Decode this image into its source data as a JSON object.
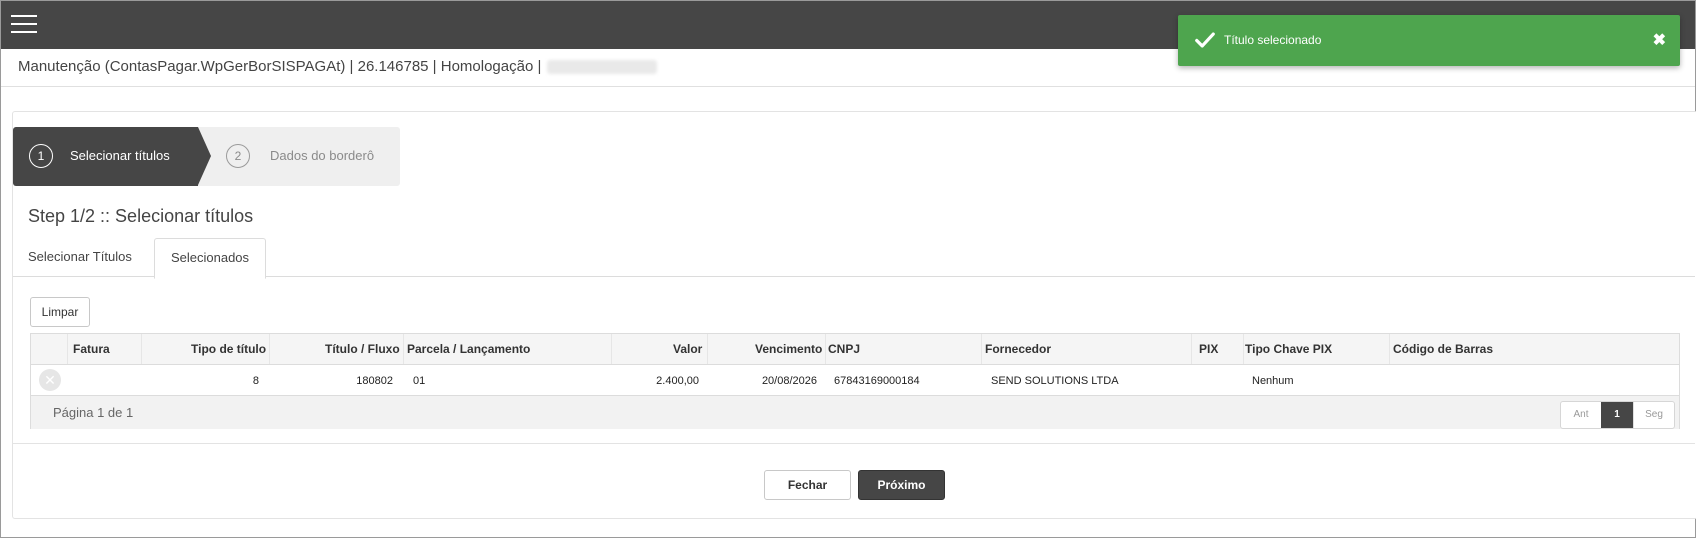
{
  "header": {
    "menu_icon": "hamburger-menu-icon"
  },
  "titleline": {
    "text": "Manutenção (ContasPagar.WpGerBorSISPAGAt) | 26.146785 | Homologação |"
  },
  "wizard": {
    "steps": [
      {
        "number": "1",
        "label": "Selecionar títulos",
        "active": true
      },
      {
        "number": "2",
        "label": "Dados do borderô",
        "active": false
      }
    ]
  },
  "step_title": "Step 1/2 :: Selecionar títulos",
  "tabs": [
    {
      "label": "Selecionar Títulos",
      "active": false
    },
    {
      "label": "Selecionados",
      "active": true
    }
  ],
  "clear_button": "Limpar",
  "grid": {
    "columns": [
      "Fatura",
      "Tipo de título",
      "Título / Fluxo",
      "Parcela / Lançamento",
      "Valor",
      "Vencimento",
      "CNPJ",
      "Fornecedor",
      "PIX",
      "Tipo Chave PIX",
      "Código de Barras"
    ],
    "rows": [
      {
        "fatura": "",
        "tipo": "8",
        "titulo": "180802",
        "parcela": "01",
        "valor": "2.400,00",
        "vencimento": "20/08/2026",
        "cnpj": "67843169000184",
        "fornecedor": "SEND SOLUTIONS LTDA",
        "pix": "",
        "tipo_chave": "Nenhum",
        "codigo_barras": ""
      }
    ],
    "page_info": "Página 1 de 1",
    "pager": {
      "prev": "Ant",
      "current": "1",
      "next": "Seg"
    }
  },
  "footer_buttons": {
    "close": "Fechar",
    "next": "Próximo"
  },
  "toast": {
    "message": "Título selecionado",
    "close_glyph": "✖",
    "color": "#4ea54e"
  },
  "colors": {
    "topbar": "#464646",
    "primary_dark": "#464646",
    "success": "#4ea54e"
  }
}
